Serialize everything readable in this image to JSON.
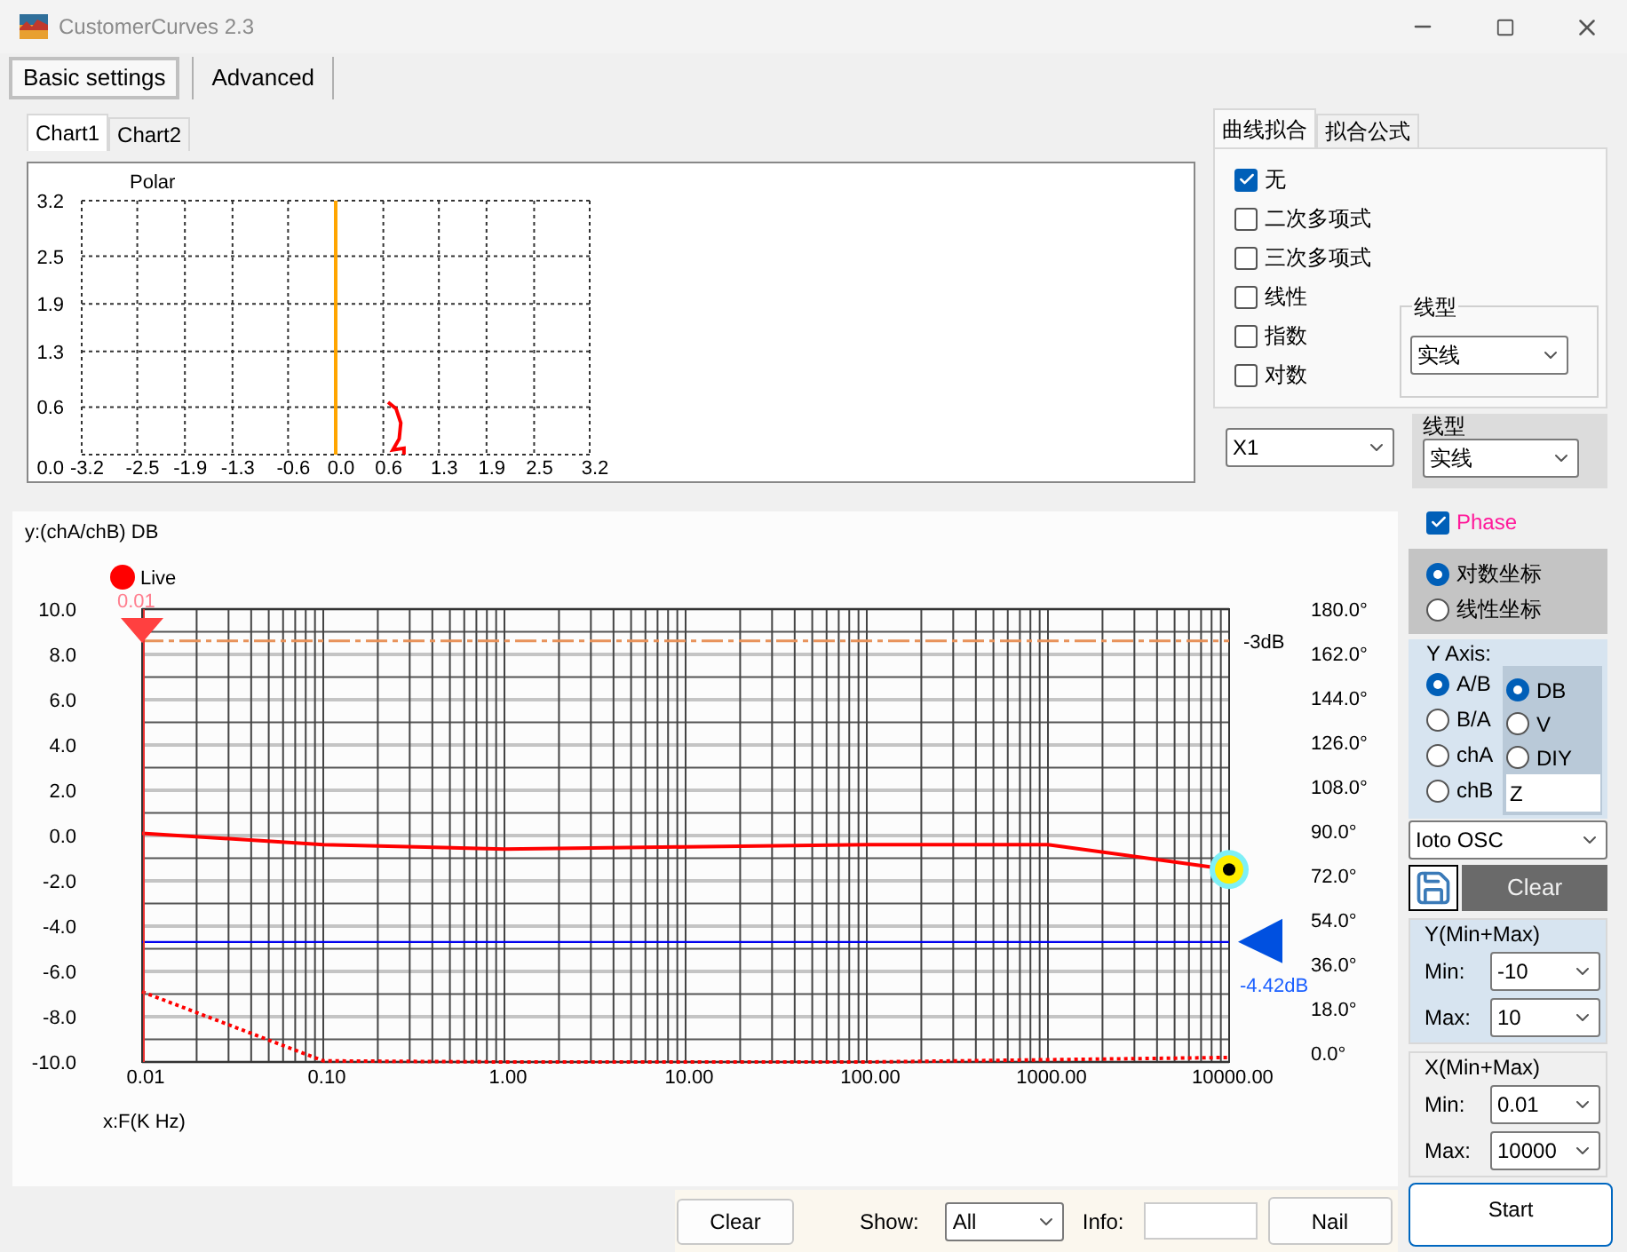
{
  "window": {
    "title": "CustomerCurves 2.3"
  },
  "main_tabs": [
    {
      "label": "Basic settings",
      "selected": true
    },
    {
      "label": "Advanced",
      "selected": false
    }
  ],
  "chart_tabs": [
    {
      "label": "Chart1",
      "selected": true
    },
    {
      "label": "Chart2",
      "selected": false
    }
  ],
  "polar_chart": {
    "chart_data": {
      "type": "line",
      "title": "Polar",
      "xticks": [
        {
          "value": -3.2,
          "label": "-3.2"
        },
        {
          "value": -2.5,
          "label": "-2.5"
        },
        {
          "value": -1.9,
          "label": "-1.9"
        },
        {
          "value": -1.3,
          "label": "-1.3"
        },
        {
          "value": -0.6,
          "label": "-0.6"
        },
        {
          "value": 0,
          "label": "0.0"
        },
        {
          "value": 0.6,
          "label": "0.6"
        },
        {
          "value": 1.3,
          "label": "1.3"
        },
        {
          "value": 1.9,
          "label": "1.9"
        },
        {
          "value": 2.5,
          "label": "2.5"
        },
        {
          "value": 3.2,
          "label": "3.2"
        }
      ],
      "yticks": [
        {
          "value": 0,
          "label": "0.0"
        },
        {
          "value": 0.6,
          "label": "0.6"
        },
        {
          "value": 1.3,
          "label": "1.3"
        },
        {
          "value": 1.9,
          "label": "1.9"
        },
        {
          "value": 2.5,
          "label": "2.5"
        },
        {
          "value": 3.2,
          "label": "3.2"
        }
      ],
      "xlim": [
        -3.2,
        3.2
      ],
      "ylim": [
        0,
        3.2
      ],
      "grid": true,
      "series": [
        {
          "color": "#ffa500",
          "x": [
            0,
            0
          ],
          "values": [
            0,
            3.2
          ]
        },
        {
          "color": "#ff0000",
          "x": [
            0.66,
            0.76,
            0.82,
            0.8,
            0.72,
            0.86,
            0.86
          ],
          "values": [
            0.66,
            0.58,
            0.4,
            0.2,
            0.06,
            0.08,
            0
          ]
        }
      ]
    }
  },
  "fit_tabs": [
    {
      "label": "曲线拟合",
      "selected": true
    },
    {
      "label": "拟合公式",
      "selected": false
    }
  ],
  "fit_options": [
    {
      "label": "无",
      "checked": true
    },
    {
      "label": "二次多项式",
      "checked": false
    },
    {
      "label": "三次多项式",
      "checked": false
    },
    {
      "label": "线性",
      "checked": false
    },
    {
      "label": "指数",
      "checked": false
    },
    {
      "label": "对数",
      "checked": false
    }
  ],
  "fit_line_type": {
    "legend": "线型",
    "value": "实线"
  },
  "curve_select": {
    "value": "X1"
  },
  "line_type": {
    "label": "线型",
    "value": "实线"
  },
  "bode_chart": {
    "live_label": "Live",
    "cursor_value": "0.01",
    "right_axis_labels": [
      "180.0°",
      "162.0°",
      "144.0°",
      "126.0°",
      "108.0°",
      "90.0°",
      "72.0°",
      "54.0°",
      "36.0°",
      "18.0°",
      "0.0°"
    ],
    "chart_data": {
      "type": "line",
      "xlabel": "x:F(K Hz)",
      "ylabel": "y:(chA/chB) DB",
      "ylim": [
        -10,
        10
      ],
      "grid": true,
      "categories": [
        "0.01",
        "0.10",
        "1.00",
        "10.00",
        "100.00",
        "1000.00",
        "10000.00"
      ],
      "yticks": [
        {
          "value": 10,
          "label": "10.0"
        },
        {
          "value": 8,
          "label": "8.0"
        },
        {
          "value": 6,
          "label": "6.0"
        },
        {
          "value": 4,
          "label": "4.0"
        },
        {
          "value": 2,
          "label": "2.0"
        },
        {
          "value": 0,
          "label": "0.0"
        },
        {
          "value": -2,
          "label": "-2.0"
        },
        {
          "value": -4,
          "label": "-4.0"
        },
        {
          "value": -6,
          "label": "-6.0"
        },
        {
          "value": -8,
          "label": "-8.0"
        },
        {
          "value": -10,
          "label": "-10.0"
        }
      ],
      "series": [
        {
          "color": "#ff0000",
          "values": [
            0.1,
            -0.4,
            -0.6,
            -0.5,
            -0.4,
            -0.4,
            -1.5
          ]
        },
        {
          "color": "#ff0000",
          "line_style": "dotted",
          "values": [
            -6.9,
            -9.95,
            -10,
            -10,
            -10,
            -9.9,
            -9.8
          ]
        }
      ],
      "ref_lines": [
        {
          "axis": "y",
          "value": 8.6,
          "label": "-3dB",
          "color": "#e8925a"
        },
        {
          "axis": "y",
          "value": -4.7,
          "label": "-4.42dB",
          "color": "#0000ee"
        }
      ]
    }
  },
  "bottom_bar": {
    "clear": "Clear",
    "show_label": "Show:",
    "show_value": "All",
    "info_label": "Info:",
    "nail": "Nail"
  },
  "phase": {
    "label": "Phase",
    "checked": true
  },
  "scale_options": [
    {
      "label": "对数坐标",
      "selected": true
    },
    {
      "label": "线性坐标",
      "selected": false
    }
  ],
  "y_axis": {
    "title": "Y Axis:",
    "sources": [
      {
        "label": "A/B",
        "selected": true
      },
      {
        "label": "B/A",
        "selected": false
      },
      {
        "label": "chA",
        "selected": false
      },
      {
        "label": "chB",
        "selected": false
      }
    ],
    "units": [
      {
        "label": "DB",
        "selected": true
      },
      {
        "label": "V",
        "selected": false
      },
      {
        "label": "DIY",
        "selected": false
      }
    ],
    "custom": "Z"
  },
  "device_select": {
    "value": "Ioto OSC"
  },
  "clear_button": "Clear",
  "y_range": {
    "title": "Y(Min+Max)",
    "min_label": "Min:",
    "min": "-10",
    "max_label": "Max:",
    "max": "10"
  },
  "x_range": {
    "title": "X(Min+Max)",
    "min_label": "Min:",
    "min": "0.01",
    "max_label": "Max:",
    "max": "10000"
  },
  "start_button": "Start"
}
